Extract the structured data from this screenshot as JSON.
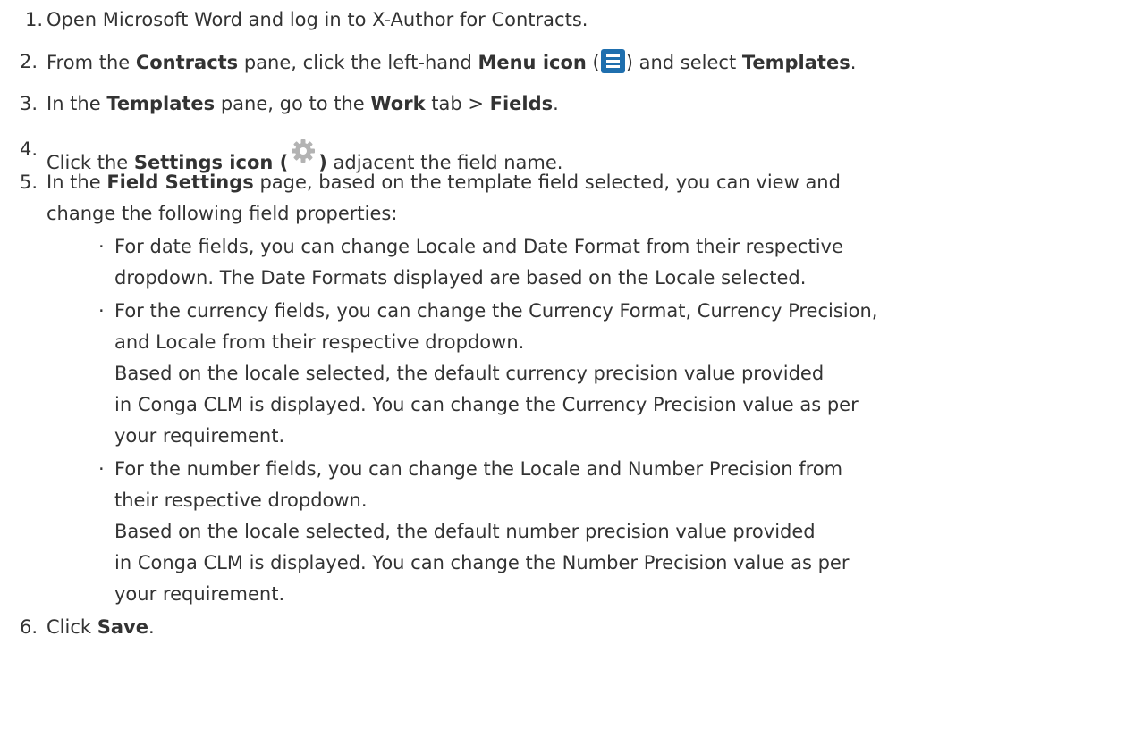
{
  "steps": [
    {
      "num": "1.",
      "text": "Open Microsoft Word and log in to X-Author for Contracts."
    },
    {
      "num": "2.",
      "t1": "From the ",
      "b1": "Contracts",
      "t2": " pane, click the left-hand ",
      "b2": "Menu icon",
      "t3": " (",
      "t4": ") and select ",
      "b3": "Templates",
      "t5": "."
    },
    {
      "num": "3.",
      "t1": "In the ",
      "b1": "Templates",
      "t2": " pane, go to the ",
      "b2": "Work",
      "t3": " tab > ",
      "b3": "Fields",
      "t4": "."
    },
    {
      "num": "4.",
      "t1": "Click the ",
      "b1": "Settings icon (",
      "b2": ")",
      "t2": " adjacent the field name."
    },
    {
      "num": "5.",
      "t1": "In the ",
      "b1": "Field Settings",
      "t2": " page, based on the template field selected, you can view and",
      "line2": "change the following field properties:"
    },
    {
      "num": "6.",
      "t1": "Click ",
      "b1": "Save",
      "t2": "."
    }
  ],
  "bullets": [
    {
      "lines": [
        "For date fields, you can change Locale and Date Format from their respective",
        "dropdown. The Date Formats displayed are based on the Locale selected."
      ]
    },
    {
      "lines": [
        "For the currency fields, you can change the Currency Format, Currency Precision,",
        "and Locale from their respective dropdown.",
        "Based on the locale selected, the default currency precision value provided",
        "in Conga CLM is displayed. You can change the Currency Precision value as per",
        "your requirement."
      ]
    },
    {
      "lines": [
        "For the number fields, you can change the Locale and Number Precision from",
        "their respective dropdown.",
        "Based on the locale selected, the default number precision value provided",
        "in Conga CLM is displayed. You can change the Number Precision value as per",
        "your requirement."
      ]
    }
  ],
  "icons": {
    "menu": "menu-icon",
    "settings": "gear-icon",
    "menu_color": "#1f6fae",
    "gear_color": "#b3b3b3"
  }
}
